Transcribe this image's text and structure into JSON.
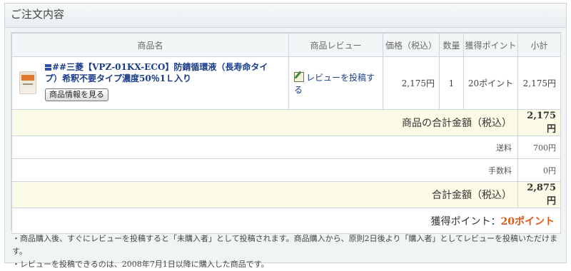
{
  "panel": {
    "title": "ご注文内容"
  },
  "table": {
    "headers": [
      "商品名",
      "商品レビュー",
      "価格（税込）",
      "数量",
      "獲得ポイント",
      "小計"
    ],
    "item": {
      "name": "##三菱【VPZ-01KX-ECO】防錆循環液（長寿命タイプ）希釈不要タイプ濃度50％1Ｌ入り",
      "info_button": "商品情報を見る",
      "review_link": "レビューを投稿する",
      "price": "2,175円",
      "quantity": "1",
      "points": "20ポイント",
      "subtotal": "2,175円"
    },
    "product_total": {
      "label": "商品の合計金額（税込）",
      "value": "2,175円"
    },
    "shipping": {
      "label": "送料",
      "value": "700円"
    },
    "fee": {
      "label": "手数料",
      "value": "0円"
    },
    "grand_total": {
      "label": "合計金額（税込）",
      "value": "2,875円"
    },
    "earned_points": {
      "label": "獲得ポイント：",
      "value": "20ポイント"
    }
  },
  "notes": [
    "・商品購入後、すぐにレビューを投稿すると「未購入者」として投稿されます。商品購入から、原則2日後より「購入者」としてレビューを投稿いただけます。",
    "・レビューを投稿できるのは、2008年7月1日以降に購入した商品です。"
  ],
  "colors": {
    "points_accent": "#e05a14",
    "link": "#1a3c8c",
    "total_bg": "#fcfbe7"
  },
  "icons": {
    "review": "pen-paper-icon",
    "product": "product-thumbnail"
  }
}
